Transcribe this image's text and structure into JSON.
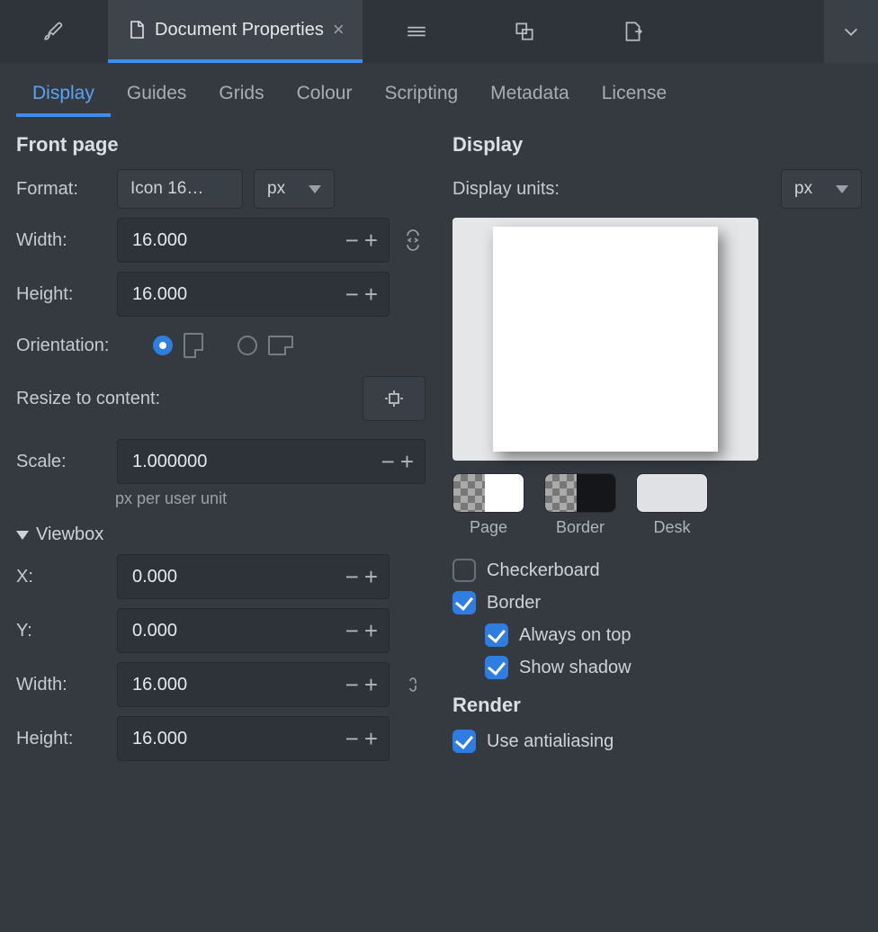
{
  "topTabs": {
    "active_label": "Document Properties"
  },
  "subTabs": [
    "Display",
    "Guides",
    "Grids",
    "Colour",
    "Scripting",
    "Metadata",
    "License"
  ],
  "left": {
    "heading": "Front page",
    "format_label": "Format:",
    "format_value": "Icon 16…",
    "format_unit": "px",
    "width_label": "Width:",
    "width_value": "16.000",
    "height_label": "Height:",
    "height_value": "16.000",
    "orientation_label": "Orientation:",
    "orientation_selected": "portrait",
    "resize_label": "Resize to content:",
    "scale_label": "Scale:",
    "scale_value": "1.000000",
    "scale_hint": "px per user unit",
    "viewbox_heading": "Viewbox",
    "vb_x_label": "X:",
    "vb_x_value": "0.000",
    "vb_y_label": "Y:",
    "vb_y_value": "0.000",
    "vb_width_label": "Width:",
    "vb_width_value": "16.000",
    "vb_height_label": "Height:",
    "vb_height_value": "16.000"
  },
  "right": {
    "heading": "Display",
    "units_label": "Display units:",
    "units_value": "px",
    "swatch_page": "Page",
    "swatch_border": "Border",
    "swatch_desk": "Desk",
    "chk_checkerboard": "Checkerboard",
    "chk_border": "Border",
    "chk_always_on_top": "Always on top",
    "chk_show_shadow": "Show shadow",
    "render_heading": "Render",
    "chk_antialias": "Use antialiasing",
    "checks": {
      "checkerboard": false,
      "border": true,
      "always_on_top": true,
      "show_shadow": true,
      "antialias": true
    }
  }
}
